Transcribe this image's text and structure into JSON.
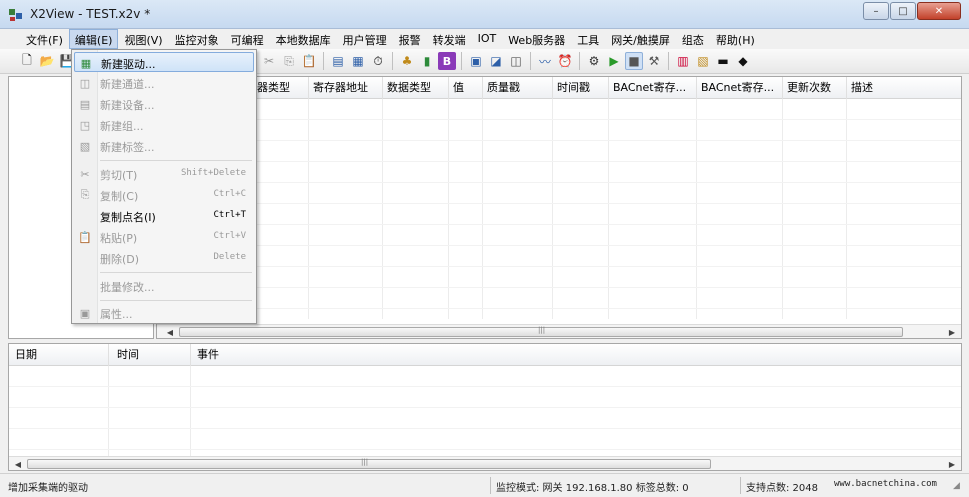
{
  "window": {
    "title": "X2View - TEST.x2v *",
    "buttons": {
      "minimize": "–",
      "maximize": "□",
      "close": "✕"
    }
  },
  "menubar": [
    {
      "label": "文件(F)"
    },
    {
      "label": "编辑(E)"
    },
    {
      "label": "视图(V)"
    },
    {
      "label": "监控对象"
    },
    {
      "label": "可编程"
    },
    {
      "label": "本地数据库"
    },
    {
      "label": "用户管理"
    },
    {
      "label": "报警"
    },
    {
      "label": "转发端"
    },
    {
      "label": "IOT"
    },
    {
      "label": "Web服务器"
    },
    {
      "label": "工具"
    },
    {
      "label": "网关/触摸屏"
    },
    {
      "label": "组态"
    },
    {
      "label": "帮助(H)"
    }
  ],
  "edit_menu": {
    "items": [
      {
        "label": "新建驱动...",
        "shortcut": "",
        "enabled": true,
        "icon": "new-driver-icon"
      },
      {
        "label": "新建通道...",
        "shortcut": "",
        "enabled": false,
        "icon": "new-channel-icon"
      },
      {
        "label": "新建设备...",
        "shortcut": "",
        "enabled": false,
        "icon": "new-device-icon"
      },
      {
        "label": "新建组...",
        "shortcut": "",
        "enabled": false,
        "icon": "new-group-icon"
      },
      {
        "label": "新建标签...",
        "shortcut": "",
        "enabled": false,
        "icon": "new-tag-icon"
      },
      {
        "label": "剪切(T)",
        "shortcut": "Shift+Delete",
        "enabled": false,
        "icon": "cut-icon"
      },
      {
        "label": "复制(C)",
        "shortcut": "Ctrl+C",
        "enabled": false,
        "icon": "copy-icon"
      },
      {
        "label": "复制点名(I)",
        "shortcut": "Ctrl+T",
        "enabled": true,
        "icon": ""
      },
      {
        "label": "粘贴(P)",
        "shortcut": "Ctrl+V",
        "enabled": false,
        "icon": "paste-icon"
      },
      {
        "label": "删除(D)",
        "shortcut": "Delete",
        "enabled": false,
        "icon": ""
      },
      {
        "label": "批量修改...",
        "shortcut": "",
        "enabled": false,
        "icon": ""
      },
      {
        "label": "属性...",
        "shortcut": "",
        "enabled": false,
        "icon": "properties-icon"
      }
    ]
  },
  "grid": {
    "columns": [
      "器类型",
      "寄存器地址",
      "数据类型",
      "值",
      "质量戳",
      "时间戳",
      "BACnet寄存...",
      "BACnet寄存...",
      "更新次数",
      "描述"
    ]
  },
  "log": {
    "columns": [
      "日期",
      "时间",
      "事件"
    ]
  },
  "statusbar": {
    "message": "增加采集端的驱动",
    "mode": "监控模式: 网关 192.168.1.80 标签总数: 0",
    "points": "支持点数: 2048",
    "website": "www.bacnetchina.com"
  },
  "colors": {
    "menu_highlight": "#cfe3f8",
    "title_bar": "#c6d9f0",
    "close_button": "#c2412a"
  }
}
